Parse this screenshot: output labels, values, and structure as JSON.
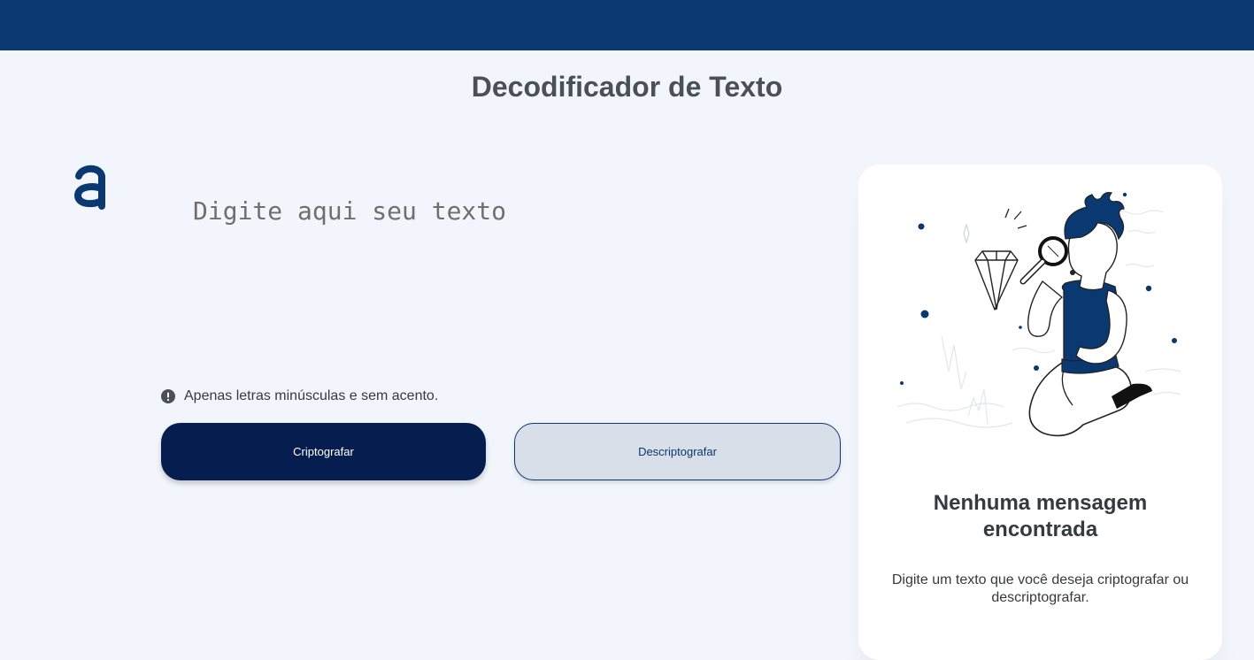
{
  "header": {
    "title": "Decodificador de Texto"
  },
  "brand": {
    "logo_icon": "alura-logo-icon",
    "primary_color": "#0a3871",
    "dark_button_color": "#061e4f",
    "background_color": "#f3f5fc"
  },
  "editor": {
    "placeholder": "Digite aqui seu texto",
    "value": ""
  },
  "hint": {
    "icon": "exclamation-circle-icon",
    "text": "Apenas letras minúsculas e sem acento."
  },
  "buttons": {
    "encrypt_label": "Criptografar",
    "decrypt_label": "Descriptografar"
  },
  "output_panel": {
    "illustration": "person-with-magnifying-glass-illustration",
    "title": "Nenhuma mensagem encontrada",
    "message": "Digite um texto que você deseja criptografar ou descriptografar."
  }
}
